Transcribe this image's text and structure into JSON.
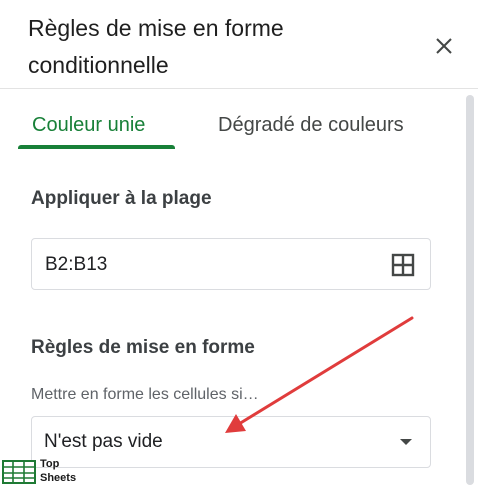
{
  "panel": {
    "title": "Règles de mise en forme conditionnelle",
    "close_icon": "close-icon"
  },
  "tabs": [
    {
      "label": "Couleur unie",
      "active": true
    },
    {
      "label": "Dégradé de couleurs",
      "active": false
    }
  ],
  "range_section": {
    "label": "Appliquer à la plage",
    "value": "B2:B13",
    "icon": "grid-select-icon"
  },
  "rules_section": {
    "label": "Règles de mise en forme",
    "helper": "Mettre en forme les cellules si…",
    "condition_value": "N'est pas vide",
    "icon": "dropdown-triangle-icon"
  },
  "annotation": {
    "color": "#e03c3c",
    "icon": "red-arrow"
  },
  "watermark": {
    "line1": "Top",
    "line2": "Sheets",
    "icon": "topsheets-logo"
  },
  "colors": {
    "accent": "#188038",
    "text": "#202124",
    "muted": "#5f6368",
    "border": "#dadce0"
  }
}
